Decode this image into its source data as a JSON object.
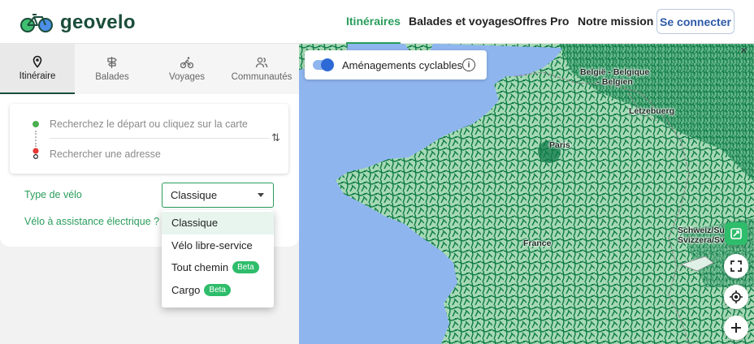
{
  "brand": {
    "name": "geovelo"
  },
  "nav": {
    "items": [
      "Itinéraires",
      "Balades et voyages",
      "Offres Pro",
      "Notre mission"
    ],
    "login": "Se connecter"
  },
  "tabs": [
    {
      "label": "Itinéraire",
      "icon": "pin-icon"
    },
    {
      "label": "Balades",
      "icon": "signpost-icon"
    },
    {
      "label": "Voyages",
      "icon": "cyclist-icon"
    },
    {
      "label": "Communautés",
      "icon": "people-icon"
    }
  ],
  "route": {
    "start_placeholder": "Recherchez le départ ou cliquez sur la carte",
    "end_placeholder": "Rechercher une adresse"
  },
  "bike": {
    "label": "Type de vélo",
    "selected": "Classique",
    "assist_link": "Vélo à assistance électrique ?",
    "options": [
      {
        "label": "Classique",
        "badge": ""
      },
      {
        "label": "Vélo libre-service",
        "badge": ""
      },
      {
        "label": "Tout chemin",
        "badge": "Beta"
      },
      {
        "label": "Cargo",
        "badge": "Beta"
      }
    ]
  },
  "map": {
    "layer_toggle": "Aménagements cyclables",
    "labels": {
      "belgique": "België - Belgique\n- Belgien",
      "luxembourg": "Letzebuerg",
      "paris": "Paris",
      "france": "France",
      "suisse": "Schweiz/Su\nSvizzera/Sv"
    }
  },
  "colors": {
    "accent": "#2a9d5c",
    "primary_blue": "#2e5aa8",
    "land": "#a6d9b4",
    "water": "#8fb5ef",
    "route": "#0d7a47"
  }
}
